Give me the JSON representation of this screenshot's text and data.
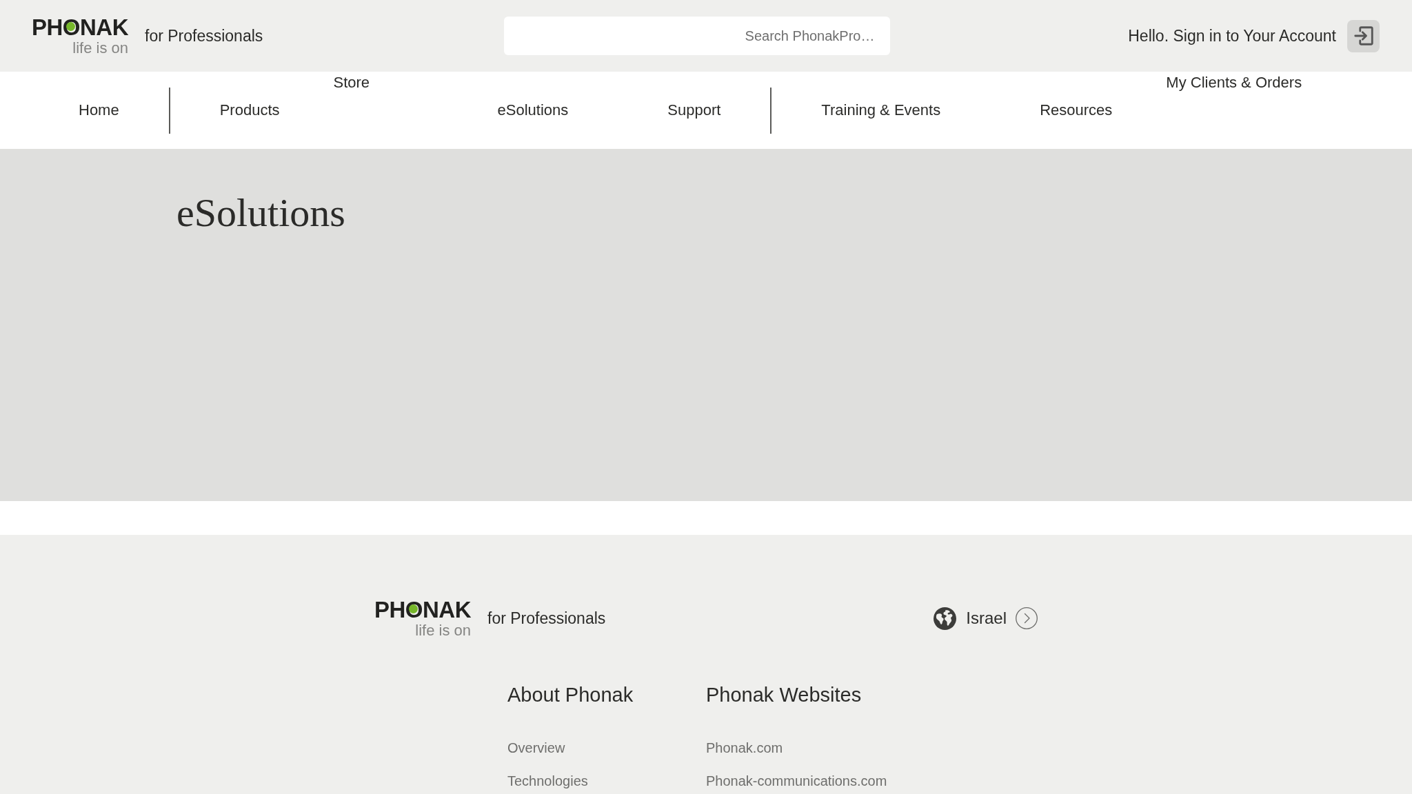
{
  "header": {
    "logo": {
      "wordmark": "PHONAK",
      "tagline": "life is on"
    },
    "site_label": "for Professionals",
    "search": {
      "placeholder": "Search PhonakPro…"
    },
    "account_link": "Hello. Sign in to Your Account"
  },
  "nav": {
    "groups": [
      {
        "items": [
          {
            "label": "Home",
            "kind": "main"
          }
        ]
      },
      {
        "items": [
          {
            "label": "Products",
            "kind": "main"
          },
          {
            "label": "Store",
            "kind": "raised"
          },
          {
            "label": "eSolutions",
            "kind": "main"
          },
          {
            "label": "Support",
            "kind": "main"
          }
        ]
      },
      {
        "items": [
          {
            "label": "Training & Events",
            "kind": "main"
          },
          {
            "label": "Resources",
            "kind": "main"
          },
          {
            "label": "My Clients & Orders",
            "kind": "raised"
          }
        ]
      }
    ]
  },
  "hero": {
    "title": "eSolutions"
  },
  "footer": {
    "logo": {
      "wordmark": "PHONAK",
      "tagline": "life is on"
    },
    "site_label": "for Professionals",
    "country": "Israel",
    "columns": [
      {
        "heading": "About Phonak",
        "links": [
          "Overview",
          "Technologies"
        ]
      },
      {
        "heading": "Phonak Websites",
        "links": [
          "Phonak.com",
          "Phonak-communications.com"
        ]
      }
    ]
  }
}
